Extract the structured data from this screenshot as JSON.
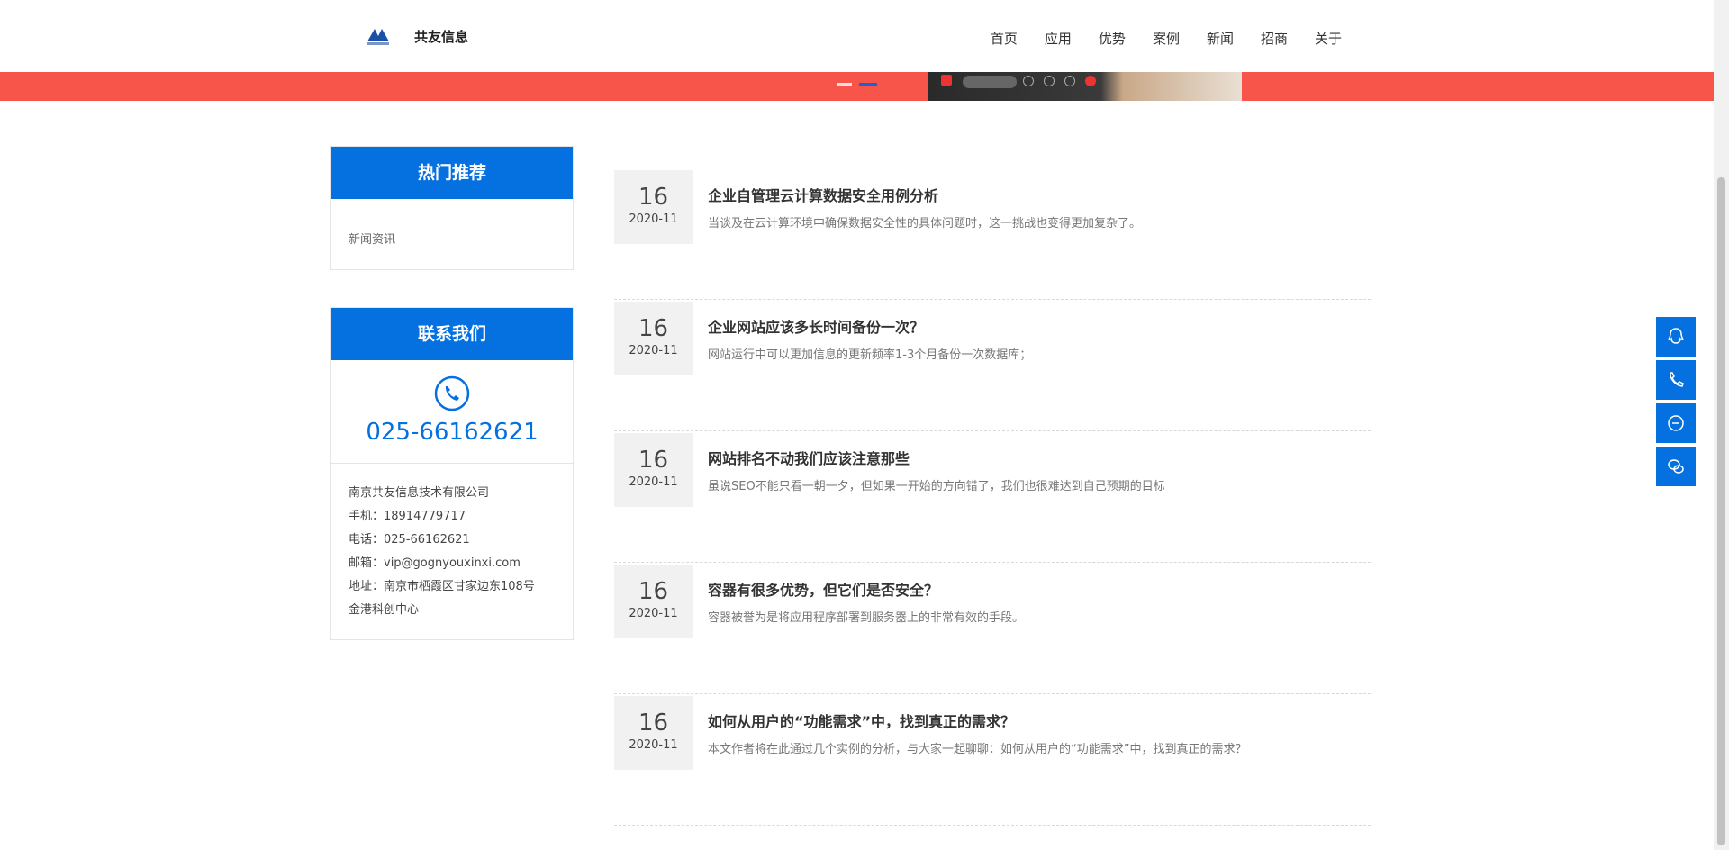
{
  "header": {
    "brand": "共友信息",
    "nav": [
      "首页",
      "应用",
      "优势",
      "案例",
      "新闻",
      "招商",
      "关于"
    ]
  },
  "sidebar": {
    "hot": {
      "title": "热门推荐",
      "link": "新闻资讯"
    },
    "contact": {
      "title": "联系我们",
      "phone": "025-66162621",
      "lines": [
        "南京共友信息技术有限公司",
        "手机：18914779717",
        "电话：025-66162621",
        "邮箱：vip@gognyouxinxi.com",
        "地址：南京市栖霞区甘家边东108号",
        "金港科创中心"
      ]
    }
  },
  "news": [
    {
      "day": "16",
      "ym": "2020-11",
      "title": "企业自管理云计算数据安全用例分析",
      "desc": "当谈及在云计算环境中确保数据安全性的具体问题时，这一挑战也变得更加复杂了。"
    },
    {
      "day": "16",
      "ym": "2020-11",
      "title": "企业网站应该多长时间备份一次？",
      "desc": "网站运行中可以更加信息的更新频率1-3个月备份一次数据库；"
    },
    {
      "day": "16",
      "ym": "2020-11",
      "title": "网站排名不动我们应该注意那些",
      "desc": "虽说SEO不能只看一朝一夕，但如果一开始的方向错了，我们也很难达到自己预期的目标"
    },
    {
      "day": "16",
      "ym": "2020-11",
      "title": "容器有很多优势，但它们是否安全？",
      "desc": "容器被誉为是将应用程序部署到服务器上的非常有效的手段。"
    },
    {
      "day": "16",
      "ym": "2020-11",
      "title": "如何从用户的“功能需求”中，找到真正的需求？",
      "desc": "本文作者将在此通过几个实例的分析，与大家一起聊聊：如何从用户的“功能需求”中，找到真正的需求？"
    }
  ],
  "colors": {
    "accent": "#0570e0",
    "banner": "#f8554a"
  }
}
